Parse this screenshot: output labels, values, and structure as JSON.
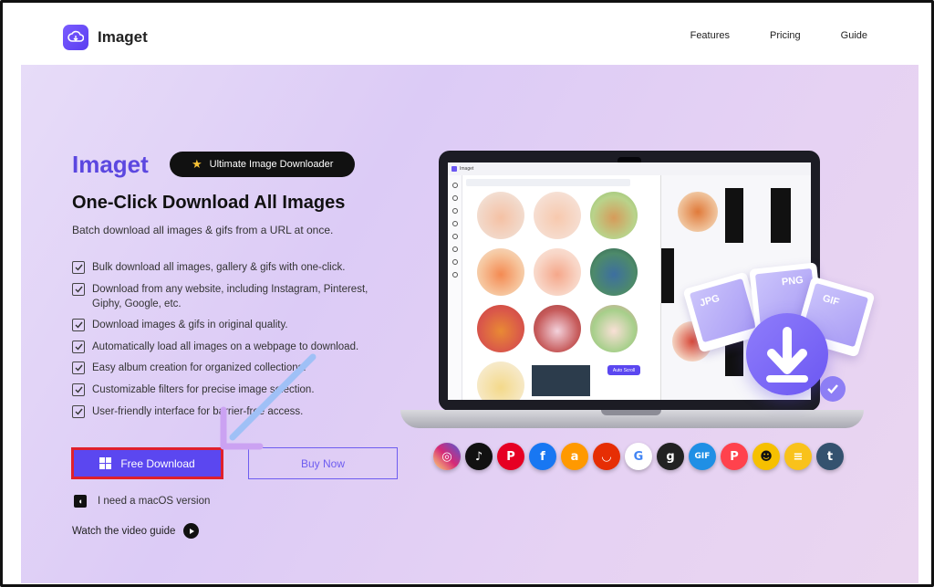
{
  "navbar": {
    "brand": "Imaget",
    "links": [
      "Features",
      "Pricing",
      "Guide"
    ]
  },
  "hero": {
    "brand": "Imaget",
    "badge": "Ultimate Image Downloader",
    "headline": "One-Click Download All Images",
    "subline": "Batch download all images & gifs from a URL at once.",
    "features": [
      "Bulk download all images, gallery & gifs with one-click.",
      "Download from any website, including Instagram, Pinterest, Giphy, Google, etc.",
      "Download images & gifs in original quality.",
      "Automatically load all images on a webpage to download.",
      "Easy album creation for organized collections.",
      "Customizable filters for precise image selection.",
      "User-friendly interface for barrier-free access."
    ],
    "free_download": "Free Download",
    "buy_now": "Buy Now",
    "mac_text": "I need a macOS version",
    "video_text": "Watch the video guide"
  },
  "mockup": {
    "app_title": "Imaget",
    "auto_scroll": "Auto Scroll",
    "cards": [
      "JPG",
      "PNG",
      "GIF"
    ]
  },
  "social_icons": [
    {
      "name": "instagram-icon",
      "color": "#d62976",
      "glyph": "◎"
    },
    {
      "name": "tiktok-icon",
      "color": "#111111",
      "glyph": "♪"
    },
    {
      "name": "pinterest-icon",
      "color": "#e60023",
      "glyph": "P"
    },
    {
      "name": "facebook-icon",
      "color": "#1877f2",
      "glyph": "f"
    },
    {
      "name": "amazon-icon",
      "color": "#ff9900",
      "glyph": "a"
    },
    {
      "name": "aliexpress-icon",
      "color": "#e62e04",
      "glyph": "◡"
    },
    {
      "name": "google-icon",
      "color": "#ffffff",
      "glyph": "G"
    },
    {
      "name": "goodreads-icon",
      "color": "#222222",
      "glyph": "g"
    },
    {
      "name": "giphy-icon",
      "color": "#1f8fe5",
      "glyph": "GIF"
    },
    {
      "name": "patreon-icon",
      "color": "#ff424d",
      "glyph": "P"
    },
    {
      "name": "grindr-icon",
      "color": "#f6c000",
      "glyph": "☻"
    },
    {
      "name": "bumble-icon",
      "color": "#f9c21b",
      "glyph": "≡"
    },
    {
      "name": "tumblr-icon",
      "color": "#34526f",
      "glyph": "t"
    }
  ],
  "colors": {
    "accent": "#5b47f0",
    "highlight_border": "#e0202c"
  }
}
